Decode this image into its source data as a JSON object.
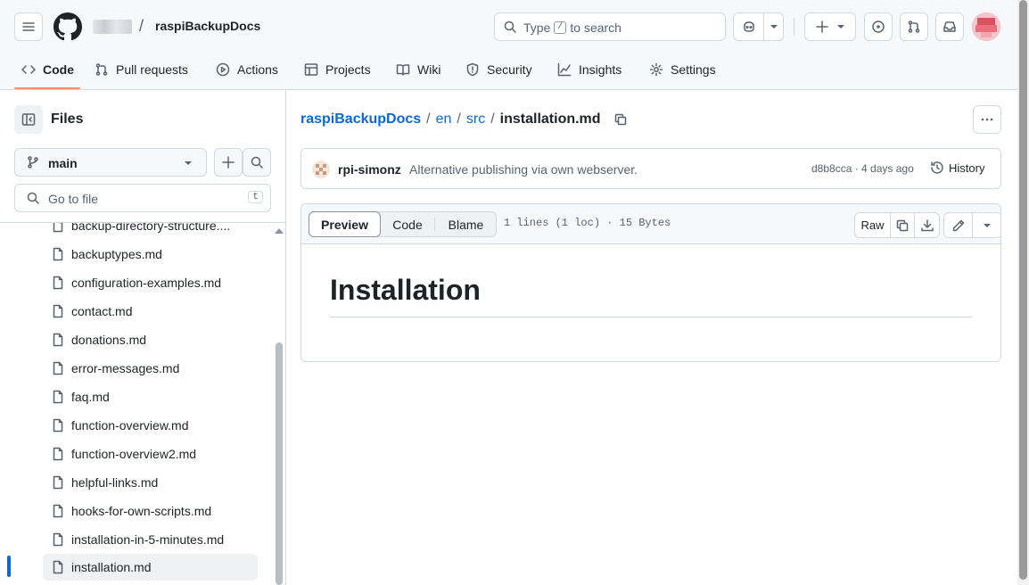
{
  "header": {
    "repo_name": "raspiBackupDocs",
    "separator": "/",
    "search": {
      "prefix": "Type",
      "key": "/",
      "suffix": "to search"
    }
  },
  "tabs": [
    {
      "label": "Code",
      "icon": "code-icon"
    },
    {
      "label": "Pull requests",
      "icon": "git-pull-request-icon"
    },
    {
      "label": "Actions",
      "icon": "play-icon"
    },
    {
      "label": "Projects",
      "icon": "table-icon"
    },
    {
      "label": "Wiki",
      "icon": "book-icon"
    },
    {
      "label": "Security",
      "icon": "shield-icon"
    },
    {
      "label": "Insights",
      "icon": "graph-icon"
    },
    {
      "label": "Settings",
      "icon": "gear-icon"
    }
  ],
  "sidebar": {
    "title": "Files",
    "branch": "main",
    "goto_placeholder": "Go to file",
    "goto_key": "t",
    "files": [
      "backup-directory-structure....",
      "backuptypes.md",
      "configuration-examples.md",
      "contact.md",
      "donations.md",
      "error-messages.md",
      "faq.md",
      "function-overview.md",
      "function-overview2.md",
      "helpful-links.md",
      "hooks-for-own-scripts.md",
      "installation-in-5-minutes.md",
      "installation.md"
    ],
    "active_file": "installation.md"
  },
  "breadcrumb": {
    "repo": "raspiBackupDocs",
    "parts": [
      "en",
      "src"
    ],
    "sep": "/",
    "current": "installation.md"
  },
  "commit": {
    "author": "rpi-simonz",
    "message": "Alternative publishing via own webserver.",
    "meta": "d8b8cca · 4 days ago",
    "history_label": "History"
  },
  "file": {
    "view_tabs": [
      "Preview",
      "Code",
      "Blame"
    ],
    "info": "1 lines (1 loc) · 15 Bytes",
    "raw_label": "Raw",
    "heading": "Installation"
  },
  "colors": {
    "accent": "#0969da",
    "tab_underline": "#fd8c73",
    "border": "#d1d9e0"
  }
}
